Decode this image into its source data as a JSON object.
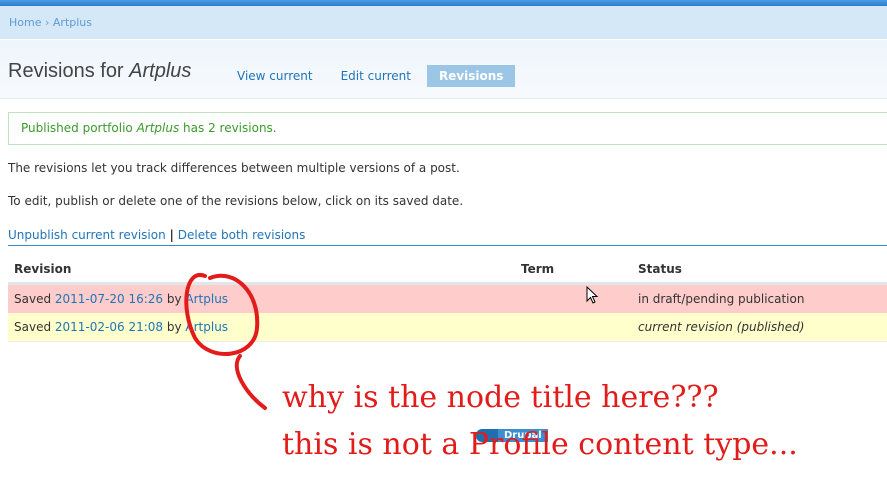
{
  "breadcrumb": {
    "home": "Home",
    "sep": "›",
    "current": "Artplus"
  },
  "header": {
    "title_prefix": "Revisions for ",
    "title_node": "Artplus"
  },
  "tabs": [
    {
      "label": "View current"
    },
    {
      "label": "Edit current"
    },
    {
      "label": "Revisions"
    }
  ],
  "message": {
    "prefix": "Published portfolio ",
    "node": "Artplus",
    "suffix": " has 2 revisions."
  },
  "intro1": "The revisions let you track differences between multiple versions of a post.",
  "intro2": "To edit, publish or delete one of the revisions below, click on its saved date.",
  "actions": {
    "unpublish": "Unpublish current revision",
    "sep": "|",
    "delete": "Delete both revisions"
  },
  "table": {
    "headers": [
      "Revision",
      "Term",
      "Status"
    ],
    "rows": [
      {
        "saved": "Saved ",
        "date": "2011-07-20 16:26",
        "by": " by ",
        "author": "Artplus",
        "term": "",
        "status": "in draft/pending publication"
      },
      {
        "saved": "Saved ",
        "date": "2011-02-06 21:08",
        "by": " by ",
        "author": "Artplus",
        "term": "",
        "status": "current revision (published)"
      }
    ]
  },
  "annotation": {
    "line1": "why is the node title here???",
    "line2": "this is not a Profile content type..."
  },
  "badge": {
    "label": "Drupal"
  }
}
